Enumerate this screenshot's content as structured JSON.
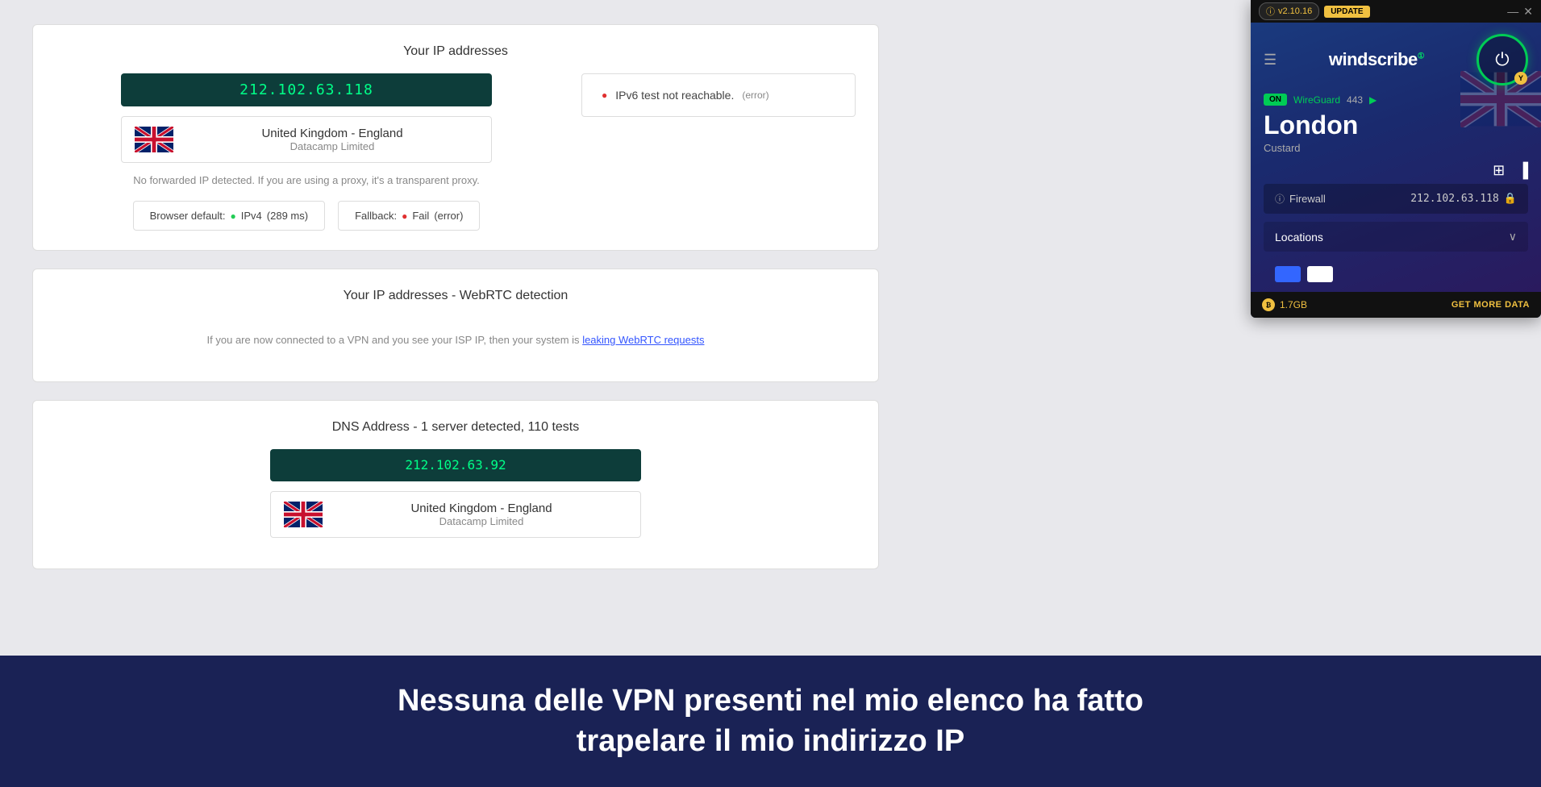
{
  "page": {
    "background": "#e8e8ec"
  },
  "main": {
    "card1": {
      "title": "Your IP addresses",
      "ip_address": "212.102.63.118",
      "country": "United Kingdom - England",
      "isp": "Datacamp Limited",
      "no_proxy": "No forwarded IP detected. If you are using a proxy, it's a transparent proxy.",
      "browser_default_label": "Browser default:",
      "protocol": "IPv4",
      "latency": "(289 ms)",
      "fallback_label": "Fallback:",
      "fallback_status": "Fail",
      "fallback_error": "(error)",
      "ipv6_label": "IPv6 test not reachable.",
      "ipv6_error": "(error)"
    },
    "card2": {
      "title": "Your IP addresses - WebRTC detection",
      "description": "If you are now connected to a VPN and you see your ISP IP, then your system is",
      "link_text": "leaking WebRTC requests"
    },
    "card3": {
      "title": "DNS Address - 1 server detected, 110 tests",
      "dns_ip": "212.102.63.92",
      "country": "United Kingdom - England",
      "isp": "Datacamp Limited"
    }
  },
  "banner": {
    "text_line1": "Nessuna delle VPN presenti nel mio elenco ha fatto",
    "text_line2": "trapelare il mio indirizzo IP"
  },
  "windscribe": {
    "version": "v2.10.16",
    "update_label": "UPDATE",
    "city": "London",
    "server": "Custard",
    "status_on": "ON",
    "protocol": "WireGuard",
    "port": "443",
    "firewall_label": "Firewall",
    "ip_display": "212.102.63.118",
    "locations_label": "Locations",
    "data_amount": "1.7GB",
    "get_more_label": "GET MORE DATA",
    "power_badge": "Y"
  }
}
